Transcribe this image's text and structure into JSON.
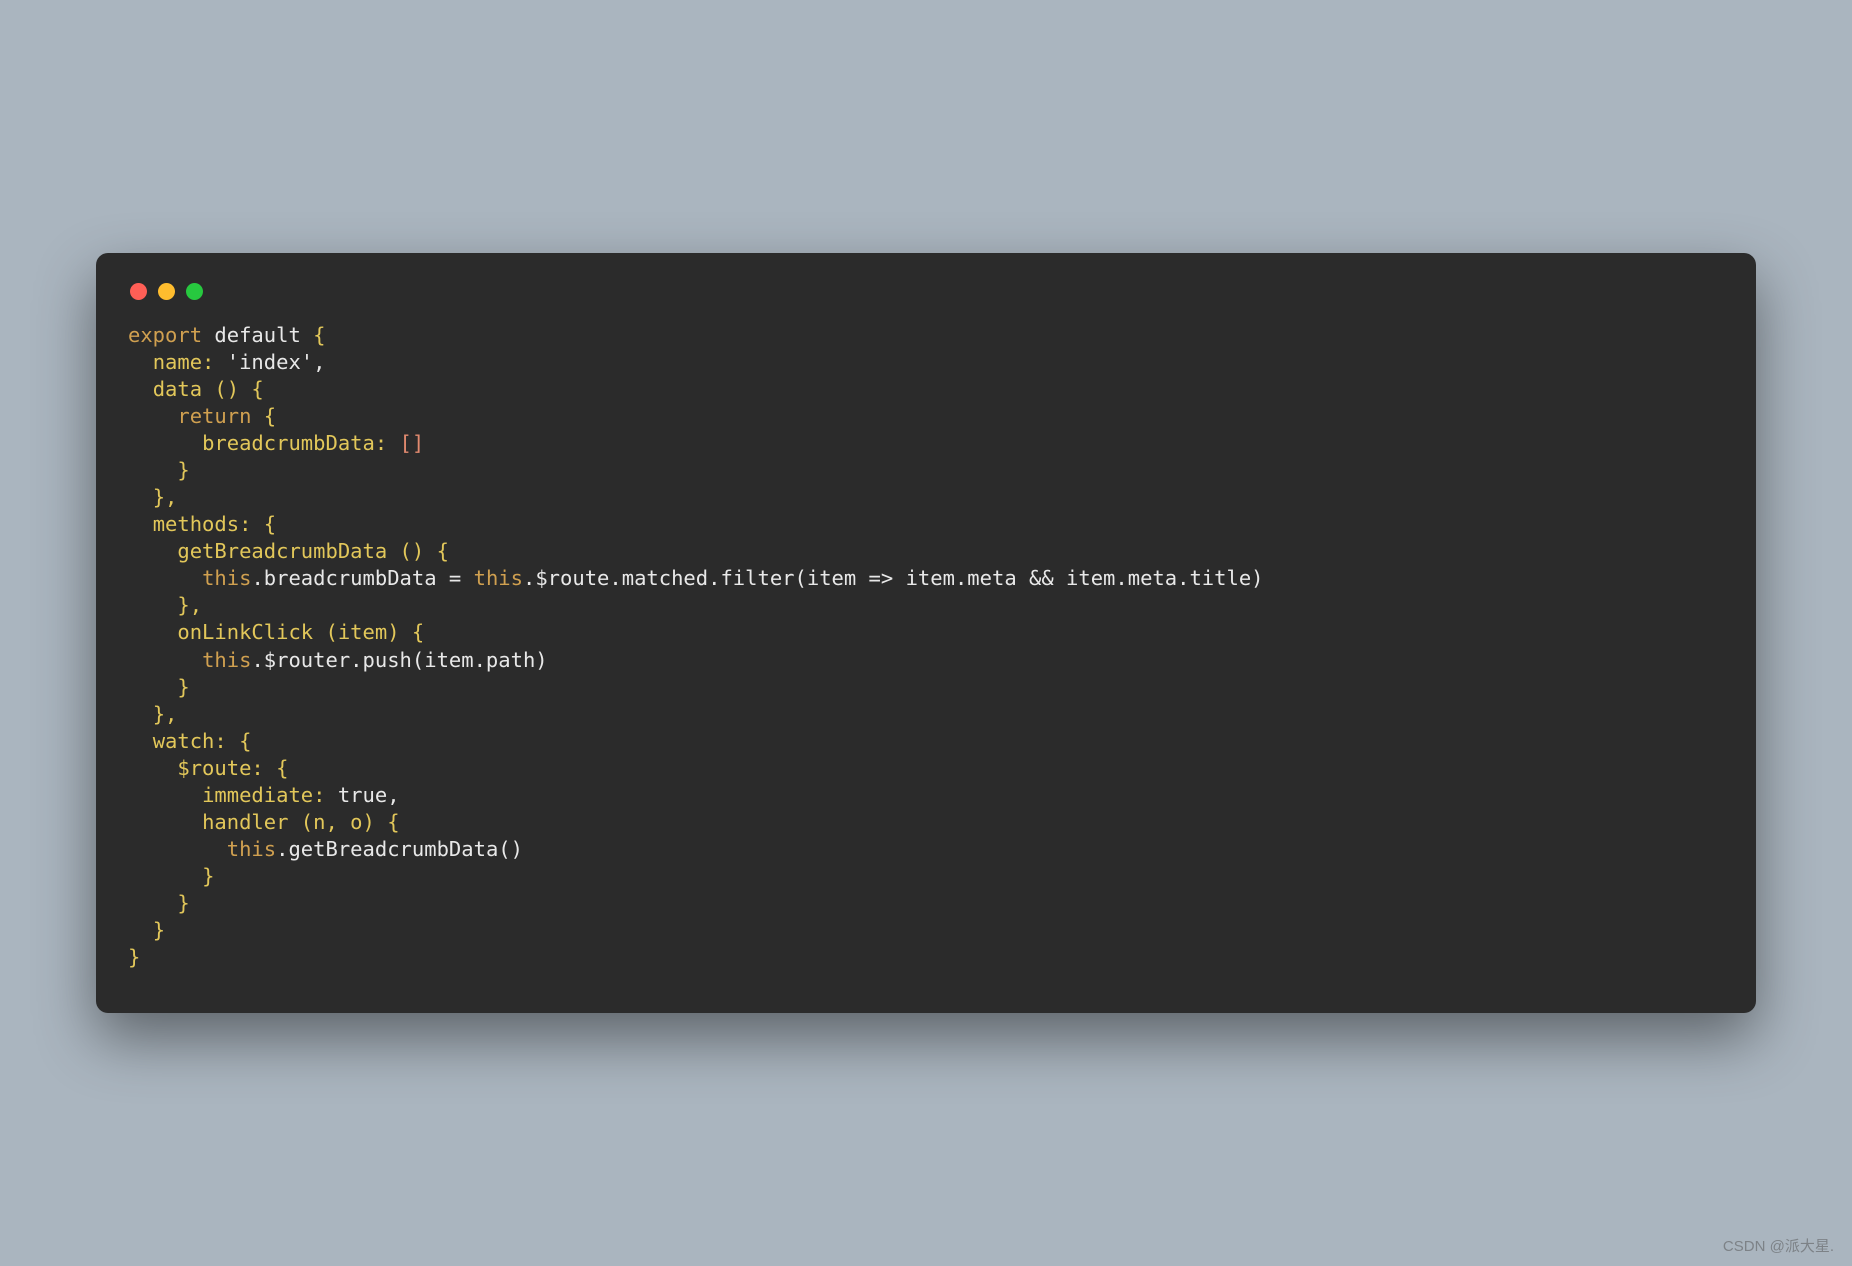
{
  "code": {
    "line1": {
      "export": "export",
      "default": "default",
      "brace": " {"
    },
    "line2": {
      "indent": "  ",
      "prop": "name:",
      "val": " 'index',"
    },
    "line3": {
      "indent": "  ",
      "prop": "data",
      "rest": " () {"
    },
    "line4": {
      "indent": "    ",
      "return": "return",
      "brace": " {"
    },
    "line5": {
      "indent": "      ",
      "prop": "breadcrumbData:",
      "arr": " []"
    },
    "line6": {
      "indent": "    ",
      "brace": "}"
    },
    "line7": {
      "indent": "  ",
      "brace": "},"
    },
    "line8": {
      "indent": "  ",
      "prop": "methods:",
      "brace": " {"
    },
    "line9": {
      "indent": "    ",
      "prop": "getBreadcrumbData",
      "rest": " () {"
    },
    "line10": {
      "indent": "      ",
      "this": "this",
      "rest1": ".breadcrumbData = ",
      "this2": "this",
      "rest2": ".$route.matched.filter(item => item.meta && item.meta.title)"
    },
    "line11": {
      "indent": "    ",
      "brace": "},"
    },
    "line12": {
      "indent": "    ",
      "prop": "onLinkClick",
      "rest": " (item) {"
    },
    "line13": {
      "indent": "      ",
      "this": "this",
      "rest": ".$router.push(item.path)"
    },
    "line14": {
      "indent": "    ",
      "brace": "}"
    },
    "line15": {
      "indent": "  ",
      "brace": "},"
    },
    "line16": {
      "indent": "  ",
      "prop": "watch:",
      "brace": " {"
    },
    "line17": {
      "indent": "    ",
      "prop": "$route:",
      "brace": " {"
    },
    "line18": {
      "indent": "      ",
      "prop": "immediate:",
      "val": " true,"
    },
    "line19": {
      "indent": "      ",
      "prop": "handler",
      "rest": " (n, o) {"
    },
    "line20": {
      "indent": "        ",
      "this": "this",
      "rest": ".getBreadcrumbData()"
    },
    "line21": {
      "indent": "      ",
      "brace": "}"
    },
    "line22": {
      "indent": "    ",
      "brace": "}"
    },
    "line23": {
      "indent": "  ",
      "brace": "}"
    },
    "line24": {
      "brace": "}"
    }
  },
  "watermark": "CSDN @派大星."
}
